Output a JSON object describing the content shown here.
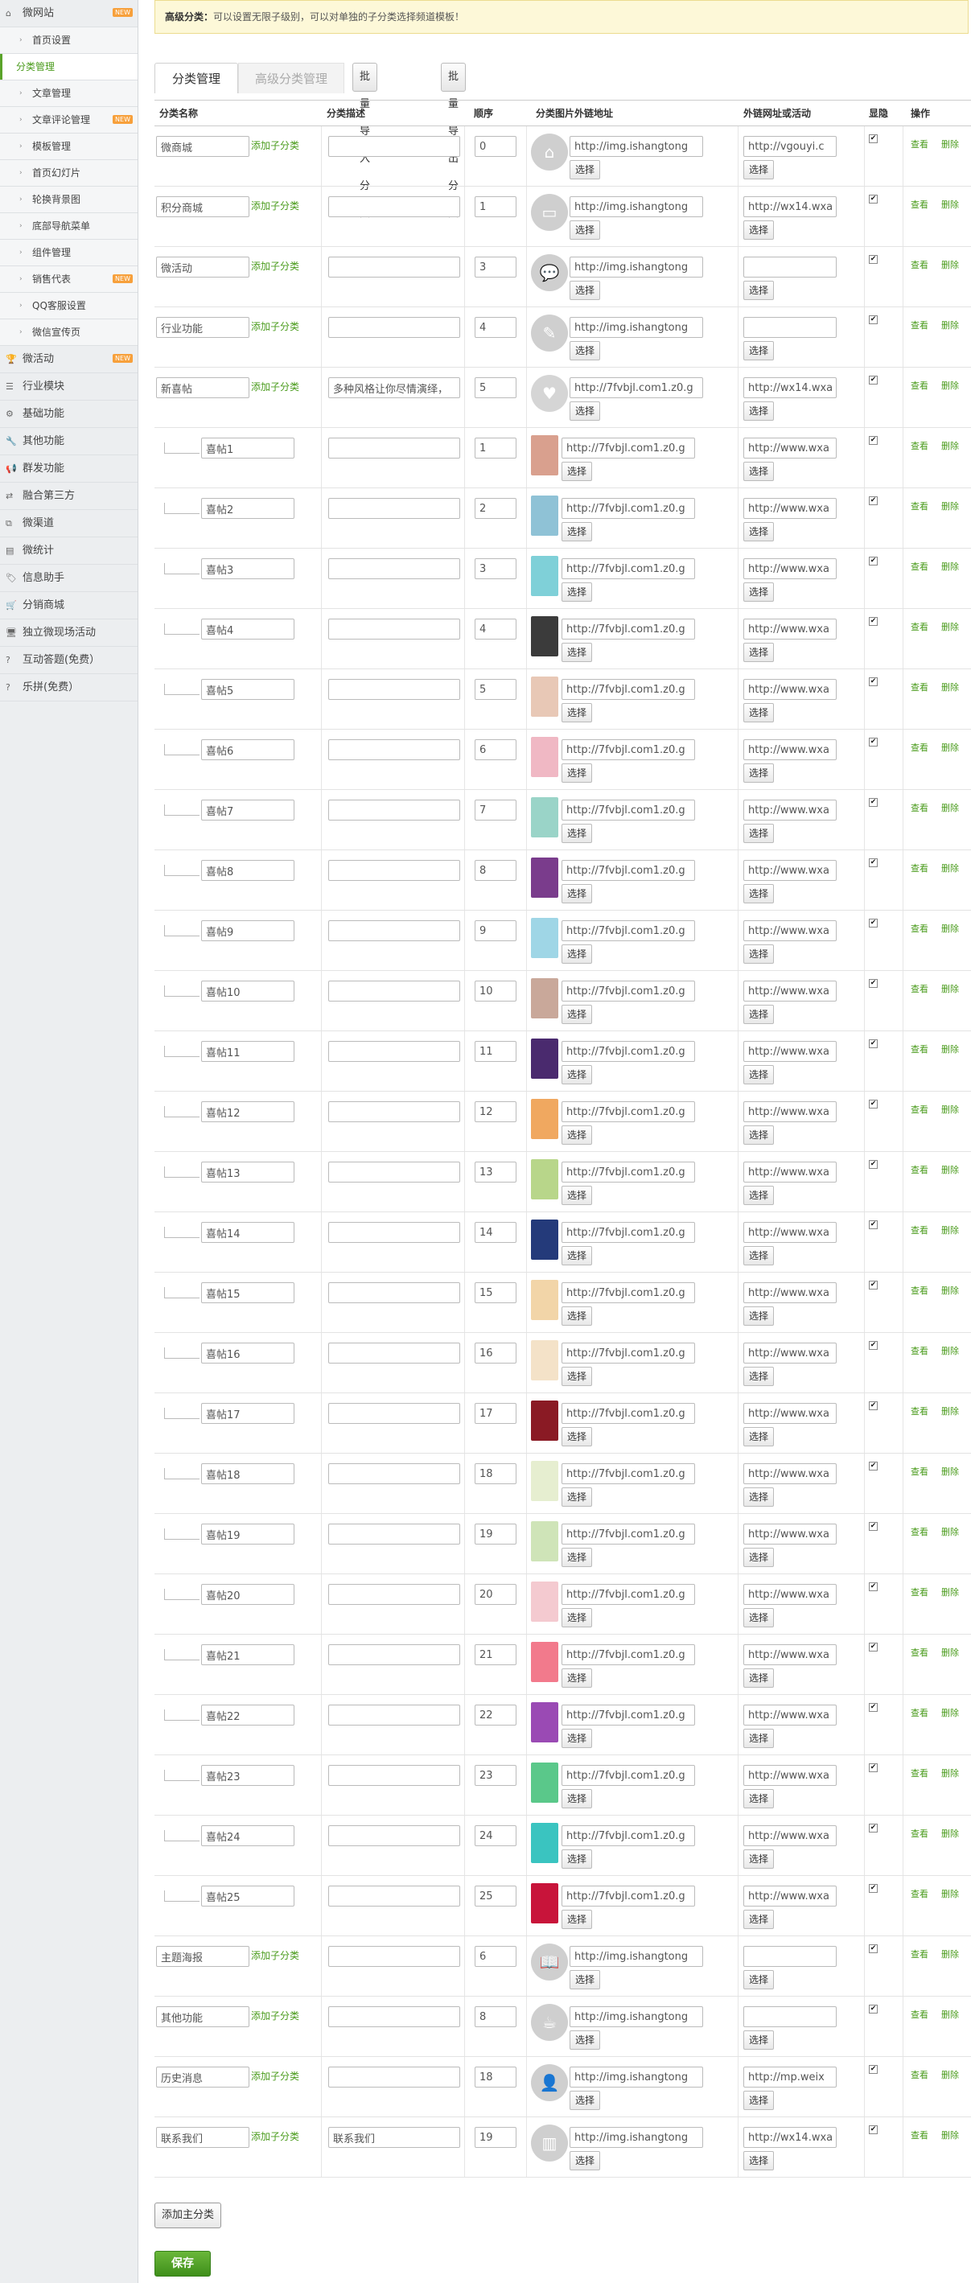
{
  "sidebar": [
    {
      "label": "微网站",
      "icon": "home-icon",
      "level": 0,
      "badge": "NEW"
    },
    {
      "label": "首页设置",
      "icon": "chevron-right-icon",
      "level": 1
    },
    {
      "label": "分类管理",
      "icon": "",
      "level": 1,
      "active": true
    },
    {
      "label": "文章管理",
      "icon": "chevron-right-icon",
      "level": 1
    },
    {
      "label": "文章评论管理",
      "icon": "chevron-right-icon",
      "level": 1,
      "badge": "NEW"
    },
    {
      "label": "模板管理",
      "icon": "chevron-right-icon",
      "level": 1
    },
    {
      "label": "首页幻灯片",
      "icon": "chevron-right-icon",
      "level": 1
    },
    {
      "label": "轮换背景图",
      "icon": "chevron-right-icon",
      "level": 1
    },
    {
      "label": "底部导航菜单",
      "icon": "chevron-right-icon",
      "level": 1
    },
    {
      "label": "组件管理",
      "icon": "chevron-right-icon",
      "level": 1
    },
    {
      "label": "销售代表",
      "icon": "chevron-right-icon",
      "level": 1,
      "badge": "NEW"
    },
    {
      "label": "QQ客服设置",
      "icon": "chevron-right-icon",
      "level": 1
    },
    {
      "label": "微信宣传页",
      "icon": "chevron-right-icon",
      "level": 1
    },
    {
      "label": "微活动",
      "icon": "trophy-icon",
      "level": 0,
      "badge": "NEW"
    },
    {
      "label": "行业模块",
      "icon": "list-icon",
      "level": 0
    },
    {
      "label": "基础功能",
      "icon": "gears-icon",
      "level": 0
    },
    {
      "label": "其他功能",
      "icon": "wrench-icon",
      "level": 0
    },
    {
      "label": "群发功能",
      "icon": "megaphone-icon",
      "level": 0
    },
    {
      "label": "融合第三方",
      "icon": "exchange-icon",
      "level": 0
    },
    {
      "label": "微渠道",
      "icon": "sitemap-icon",
      "level": 0
    },
    {
      "label": "微统计",
      "icon": "chart-icon",
      "level": 0
    },
    {
      "label": "信息助手",
      "icon": "tags-icon",
      "level": 0
    },
    {
      "label": "分销商城",
      "icon": "cart-icon",
      "level": 0
    },
    {
      "label": "独立微现场活动",
      "icon": "monitor-icon",
      "level": 0
    },
    {
      "label": "互动答题(免费）",
      "icon": "question-icon",
      "level": 0
    },
    {
      "label": "乐拼(免费）",
      "icon": "question-icon",
      "level": 0
    }
  ],
  "notice": {
    "title": "高级分类：",
    "text": "可以设置无限子级别，可以对单独的子分类选择频道模板！"
  },
  "tabs": {
    "basic": "分类管理",
    "advanced": "高级分类管理",
    "import": "批量导入分类",
    "export": "批量导出分类"
  },
  "columns": {
    "name": "分类名称",
    "desc": "分类描述",
    "order": "顺序",
    "img": "分类图片外链地址",
    "link": "外链网址或活动",
    "show": "显隐",
    "ops": "操作"
  },
  "labels": {
    "add_sub": "添加子分类",
    "choose": "选择",
    "view": "查看",
    "delete": "删除",
    "add_main": "添加主分类",
    "save": "保存",
    "checked_mark": "✔"
  },
  "rows": [
    {
      "name": "微商城",
      "desc": "",
      "order": "0",
      "img": "http://img.ishangtong",
      "link": "http://vgouyi.c",
      "child": false,
      "thumb": "#cfcfcf",
      "icon": "home-icon"
    },
    {
      "name": "积分商城",
      "desc": "",
      "order": "1",
      "img": "http://img.ishangtong",
      "link": "http://wx14.wxa",
      "child": false,
      "thumb": "#cfcfcf",
      "icon": "card-icon"
    },
    {
      "name": "微活动",
      "desc": "",
      "order": "3",
      "img": "http://img.ishangtong",
      "link": "",
      "child": false,
      "thumb": "#cfcfcf",
      "icon": "chat-icon"
    },
    {
      "name": "行业功能",
      "desc": "",
      "order": "4",
      "img": "http://img.ishangtong",
      "link": "",
      "child": false,
      "thumb": "#cfcfcf",
      "icon": "edit-icon"
    },
    {
      "name": "新喜帖",
      "desc": "多种风格让你尽情演绎，",
      "order": "5",
      "img": "http://7fvbjl.com1.z0.g",
      "link": "http://wx14.wxa",
      "child": false,
      "thumb": "#d5d5d5",
      "icon": "heart-icon"
    },
    {
      "name": "喜帖1",
      "desc": "",
      "order": "1",
      "img": "http://7fvbjl.com1.z0.g",
      "link": "http://www.wxa",
      "child": true,
      "thumb": "#d9a08e"
    },
    {
      "name": "喜帖2",
      "desc": "",
      "order": "2",
      "img": "http://7fvbjl.com1.z0.g",
      "link": "http://www.wxa",
      "child": true,
      "thumb": "#8fc2d6"
    },
    {
      "name": "喜帖3",
      "desc": "",
      "order": "3",
      "img": "http://7fvbjl.com1.z0.g",
      "link": "http://www.wxa",
      "child": true,
      "thumb": "#7fd0d8"
    },
    {
      "name": "喜帖4",
      "desc": "",
      "order": "4",
      "img": "http://7fvbjl.com1.z0.g",
      "link": "http://www.wxa",
      "child": true,
      "thumb": "#3b3b3b"
    },
    {
      "name": "喜帖5",
      "desc": "",
      "order": "5",
      "img": "http://7fvbjl.com1.z0.g",
      "link": "http://www.wxa",
      "child": true,
      "thumb": "#e8c8b6"
    },
    {
      "name": "喜帖6",
      "desc": "",
      "order": "6",
      "img": "http://7fvbjl.com1.z0.g",
      "link": "http://www.wxa",
      "child": true,
      "thumb": "#f0b8c4"
    },
    {
      "name": "喜帖7",
      "desc": "",
      "order": "7",
      "img": "http://7fvbjl.com1.z0.g",
      "link": "http://www.wxa",
      "child": true,
      "thumb": "#9ad4c8"
    },
    {
      "name": "喜帖8",
      "desc": "",
      "order": "8",
      "img": "http://7fvbjl.com1.z0.g",
      "link": "http://www.wxa",
      "child": true,
      "thumb": "#7a3c8c"
    },
    {
      "name": "喜帖9",
      "desc": "",
      "order": "9",
      "img": "http://7fvbjl.com1.z0.g",
      "link": "http://www.wxa",
      "child": true,
      "thumb": "#9fd6e6"
    },
    {
      "name": "喜帖10",
      "desc": "",
      "order": "10",
      "img": "http://7fvbjl.com1.z0.g",
      "link": "http://www.wxa",
      "child": true,
      "thumb": "#c9a89a"
    },
    {
      "name": "喜帖11",
      "desc": "",
      "order": "11",
      "img": "http://7fvbjl.com1.z0.g",
      "link": "http://www.wxa",
      "child": true,
      "thumb": "#4a2a6e"
    },
    {
      "name": "喜帖12",
      "desc": "",
      "order": "12",
      "img": "http://7fvbjl.com1.z0.g",
      "link": "http://www.wxa",
      "child": true,
      "thumb": "#f0a860"
    },
    {
      "name": "喜帖13",
      "desc": "",
      "order": "13",
      "img": "http://7fvbjl.com1.z0.g",
      "link": "http://www.wxa",
      "child": true,
      "thumb": "#b8d68a"
    },
    {
      "name": "喜帖14",
      "desc": "",
      "order": "14",
      "img": "http://7fvbjl.com1.z0.g",
      "link": "http://www.wxa",
      "child": true,
      "thumb": "#243a7a"
    },
    {
      "name": "喜帖15",
      "desc": "",
      "order": "15",
      "img": "http://7fvbjl.com1.z0.g",
      "link": "http://www.wxa",
      "child": true,
      "thumb": "#f2d5a8"
    },
    {
      "name": "喜帖16",
      "desc": "",
      "order": "16",
      "img": "http://7fvbjl.com1.z0.g",
      "link": "http://www.wxa",
      "child": true,
      "thumb": "#f4e2c8"
    },
    {
      "name": "喜帖17",
      "desc": "",
      "order": "17",
      "img": "http://7fvbjl.com1.z0.g",
      "link": "http://www.wxa",
      "child": true,
      "thumb": "#8a1a24"
    },
    {
      "name": "喜帖18",
      "desc": "",
      "order": "18",
      "img": "http://7fvbjl.com1.z0.g",
      "link": "http://www.wxa",
      "child": true,
      "thumb": "#e6eed0"
    },
    {
      "name": "喜帖19",
      "desc": "",
      "order": "19",
      "img": "http://7fvbjl.com1.z0.g",
      "link": "http://www.wxa",
      "child": true,
      "thumb": "#cfe4b8"
    },
    {
      "name": "喜帖20",
      "desc": "",
      "order": "20",
      "img": "http://7fvbjl.com1.z0.g",
      "link": "http://www.wxa",
      "child": true,
      "thumb": "#f4cad0"
    },
    {
      "name": "喜帖21",
      "desc": "",
      "order": "21",
      "img": "http://7fvbjl.com1.z0.g",
      "link": "http://www.wxa",
      "child": true,
      "thumb": "#f27a8c"
    },
    {
      "name": "喜帖22",
      "desc": "",
      "order": "22",
      "img": "http://7fvbjl.com1.z0.g",
      "link": "http://www.wxa",
      "child": true,
      "thumb": "#9a4ab4"
    },
    {
      "name": "喜帖23",
      "desc": "",
      "order": "23",
      "img": "http://7fvbjl.com1.z0.g",
      "link": "http://www.wxa",
      "child": true,
      "thumb": "#5ac88a"
    },
    {
      "name": "喜帖24",
      "desc": "",
      "order": "24",
      "img": "http://7fvbjl.com1.z0.g",
      "link": "http://www.wxa",
      "child": true,
      "thumb": "#3ac4c0"
    },
    {
      "name": "喜帖25",
      "desc": "",
      "order": "25",
      "img": "http://7fvbjl.com1.z0.g",
      "link": "http://www.wxa",
      "child": true,
      "thumb": "#c8143a"
    },
    {
      "name": "主题海报",
      "desc": "",
      "order": "6",
      "img": "http://img.ishangtong",
      "link": "",
      "child": false,
      "thumb": "#cfcfcf",
      "icon": "book-icon"
    },
    {
      "name": "其他功能",
      "desc": "",
      "order": "8",
      "img": "http://img.ishangtong",
      "link": "",
      "child": false,
      "thumb": "#cfcfcf",
      "icon": "cup-icon"
    },
    {
      "name": "历史消息",
      "desc": "",
      "order": "18",
      "img": "http://img.ishangtong",
      "link": "http://mp.weix",
      "child": false,
      "thumb": "#cfcfcf",
      "icon": "id-card-icon"
    },
    {
      "name": "联系我们",
      "desc": "联系我们",
      "order": "19",
      "img": "http://img.ishangtong",
      "link": "http://wx14.wxa",
      "child": false,
      "thumb": "#cfcfcf",
      "icon": "building-icon"
    }
  ]
}
